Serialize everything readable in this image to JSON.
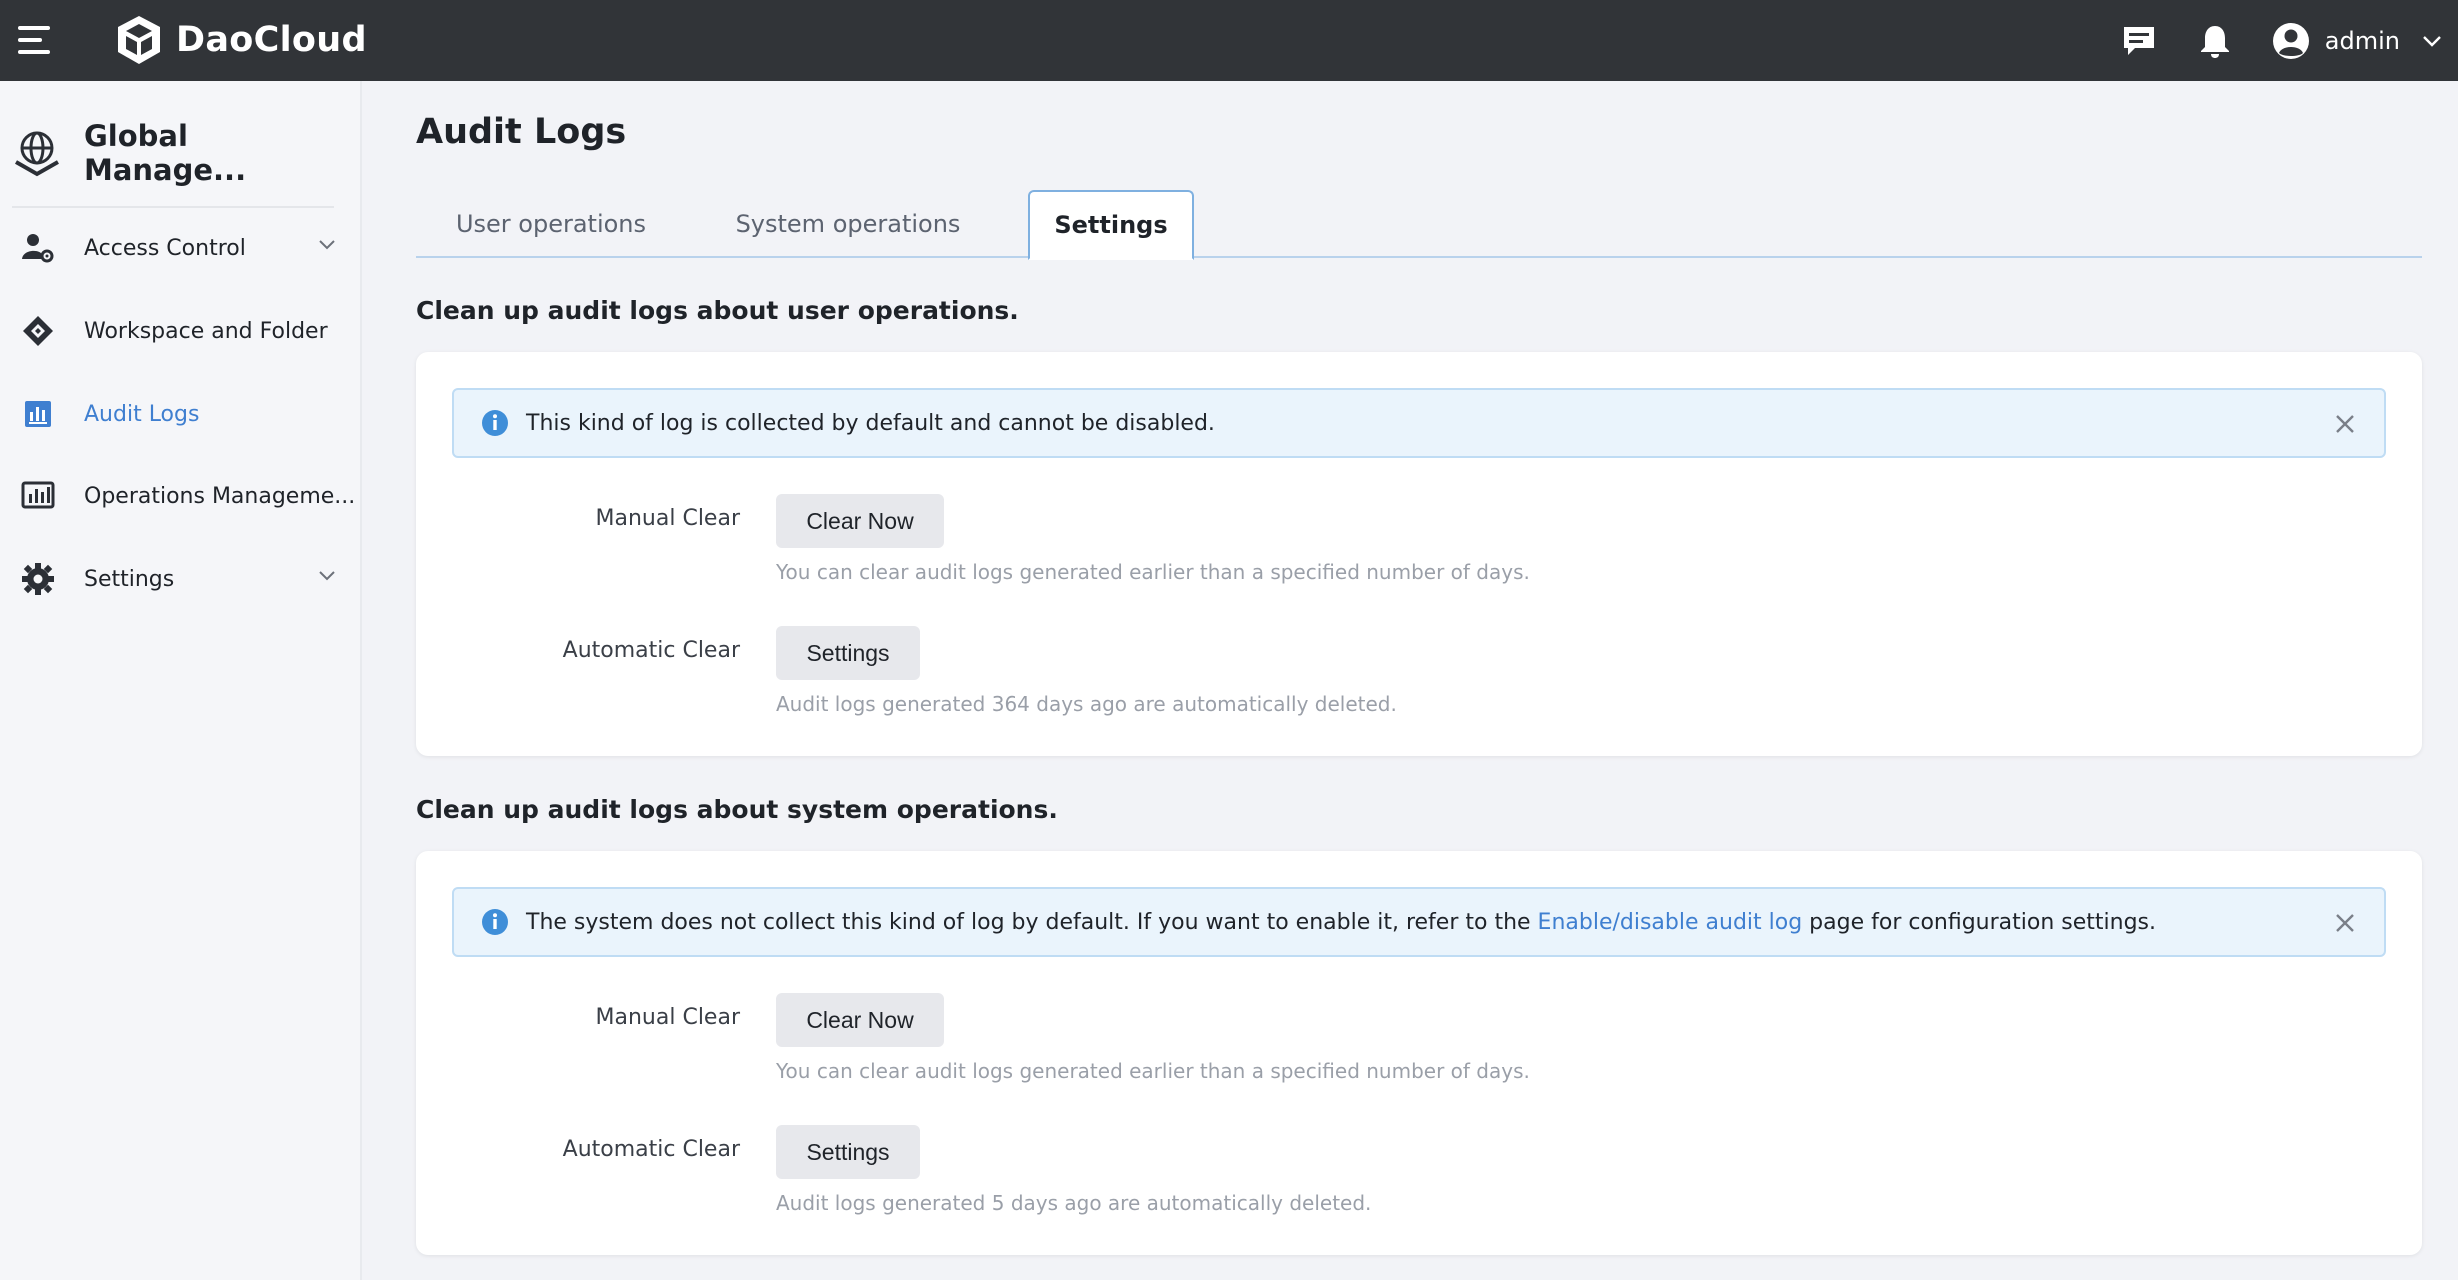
{
  "brand": {
    "name": "DaoCloud"
  },
  "header": {
    "user": "admin"
  },
  "sidebar": {
    "title": "Global Manage...",
    "items": [
      {
        "label": "Access Control",
        "icon": "user-gear-icon",
        "expandable": true
      },
      {
        "label": "Workspace and Folder",
        "icon": "workspace-icon",
        "expandable": false
      },
      {
        "label": "Audit Logs",
        "icon": "bar-chart-icon",
        "expandable": false,
        "active": true
      },
      {
        "label": "Operations Manageme...",
        "icon": "monitor-chart-icon",
        "expandable": false
      },
      {
        "label": "Settings",
        "icon": "gear-icon",
        "expandable": true
      }
    ]
  },
  "page": {
    "title": "Audit Logs",
    "tabs": [
      {
        "label": "User operations"
      },
      {
        "label": "System operations"
      },
      {
        "label": "Settings",
        "active": true
      }
    ]
  },
  "sections": [
    {
      "heading": "Clean up audit logs about user operations.",
      "alert": {
        "text": "This kind of log is collected by default and cannot be disabled."
      },
      "manual_label": "Manual Clear",
      "manual_button": "Clear Now",
      "manual_hint": "You can clear audit logs generated earlier than a specified number of days.",
      "auto_label": "Automatic Clear",
      "auto_button": "Settings",
      "auto_hint": "Audit logs generated 364 days ago are automatically deleted."
    },
    {
      "heading": "Clean up audit logs about system operations.",
      "alert": {
        "text_before": "The system does not collect this kind of log by default. If you want to enable it, refer to the ",
        "link": "Enable/disable audit log",
        "text_after": " page for configuration settings."
      },
      "manual_label": "Manual Clear",
      "manual_button": "Clear Now",
      "manual_hint": "You can clear audit logs generated earlier than a specified number of days.",
      "auto_label": "Automatic Clear",
      "auto_button": "Settings",
      "auto_hint": "Audit logs generated 5 days ago are automatically deleted."
    }
  ],
  "colors": {
    "topbar": "#313438",
    "accent": "#3f7fd0",
    "alert_bg": "#eaf4fc"
  }
}
